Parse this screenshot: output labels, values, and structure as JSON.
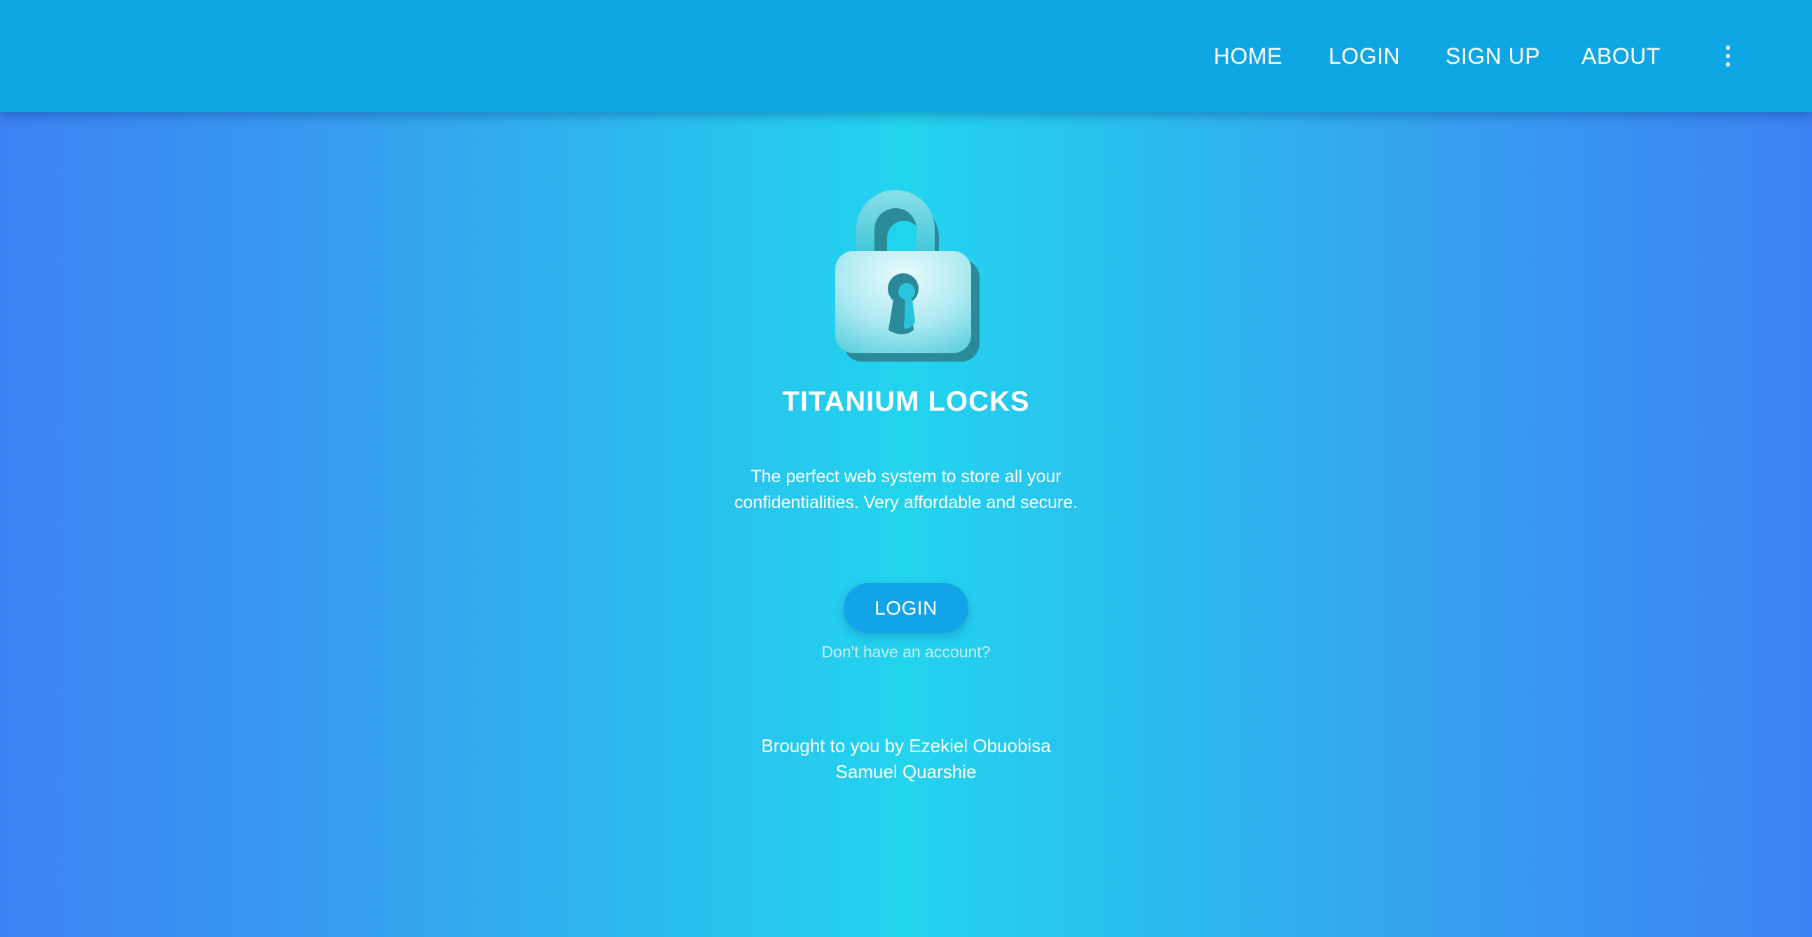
{
  "nav": {
    "items": [
      {
        "label": "HOME"
      },
      {
        "label": "LOGIN"
      },
      {
        "label": "SIGN UP"
      },
      {
        "label": "ABOUT"
      }
    ],
    "more_icon": "more-vertical-icon"
  },
  "hero": {
    "logo_icon": "padlock-icon",
    "title": "TITANIUM LOCKS",
    "tagline_line1": "The perfect web system to store all your",
    "tagline_line2": "confidentialities. Very affordable and secure.",
    "login_label": "LOGIN",
    "signup_prompt": "Don't have an account?"
  },
  "credits": {
    "line1": "Brought to you by Ezekiel Obuobisa",
    "line2": "Samuel Quarshie"
  },
  "colors": {
    "navbar": "#0fa6e6",
    "background_center": "#22d4ee",
    "background_edge": "#3d82f4",
    "button": "#12a3e8",
    "lock_shadow": "#2a8a9a"
  }
}
